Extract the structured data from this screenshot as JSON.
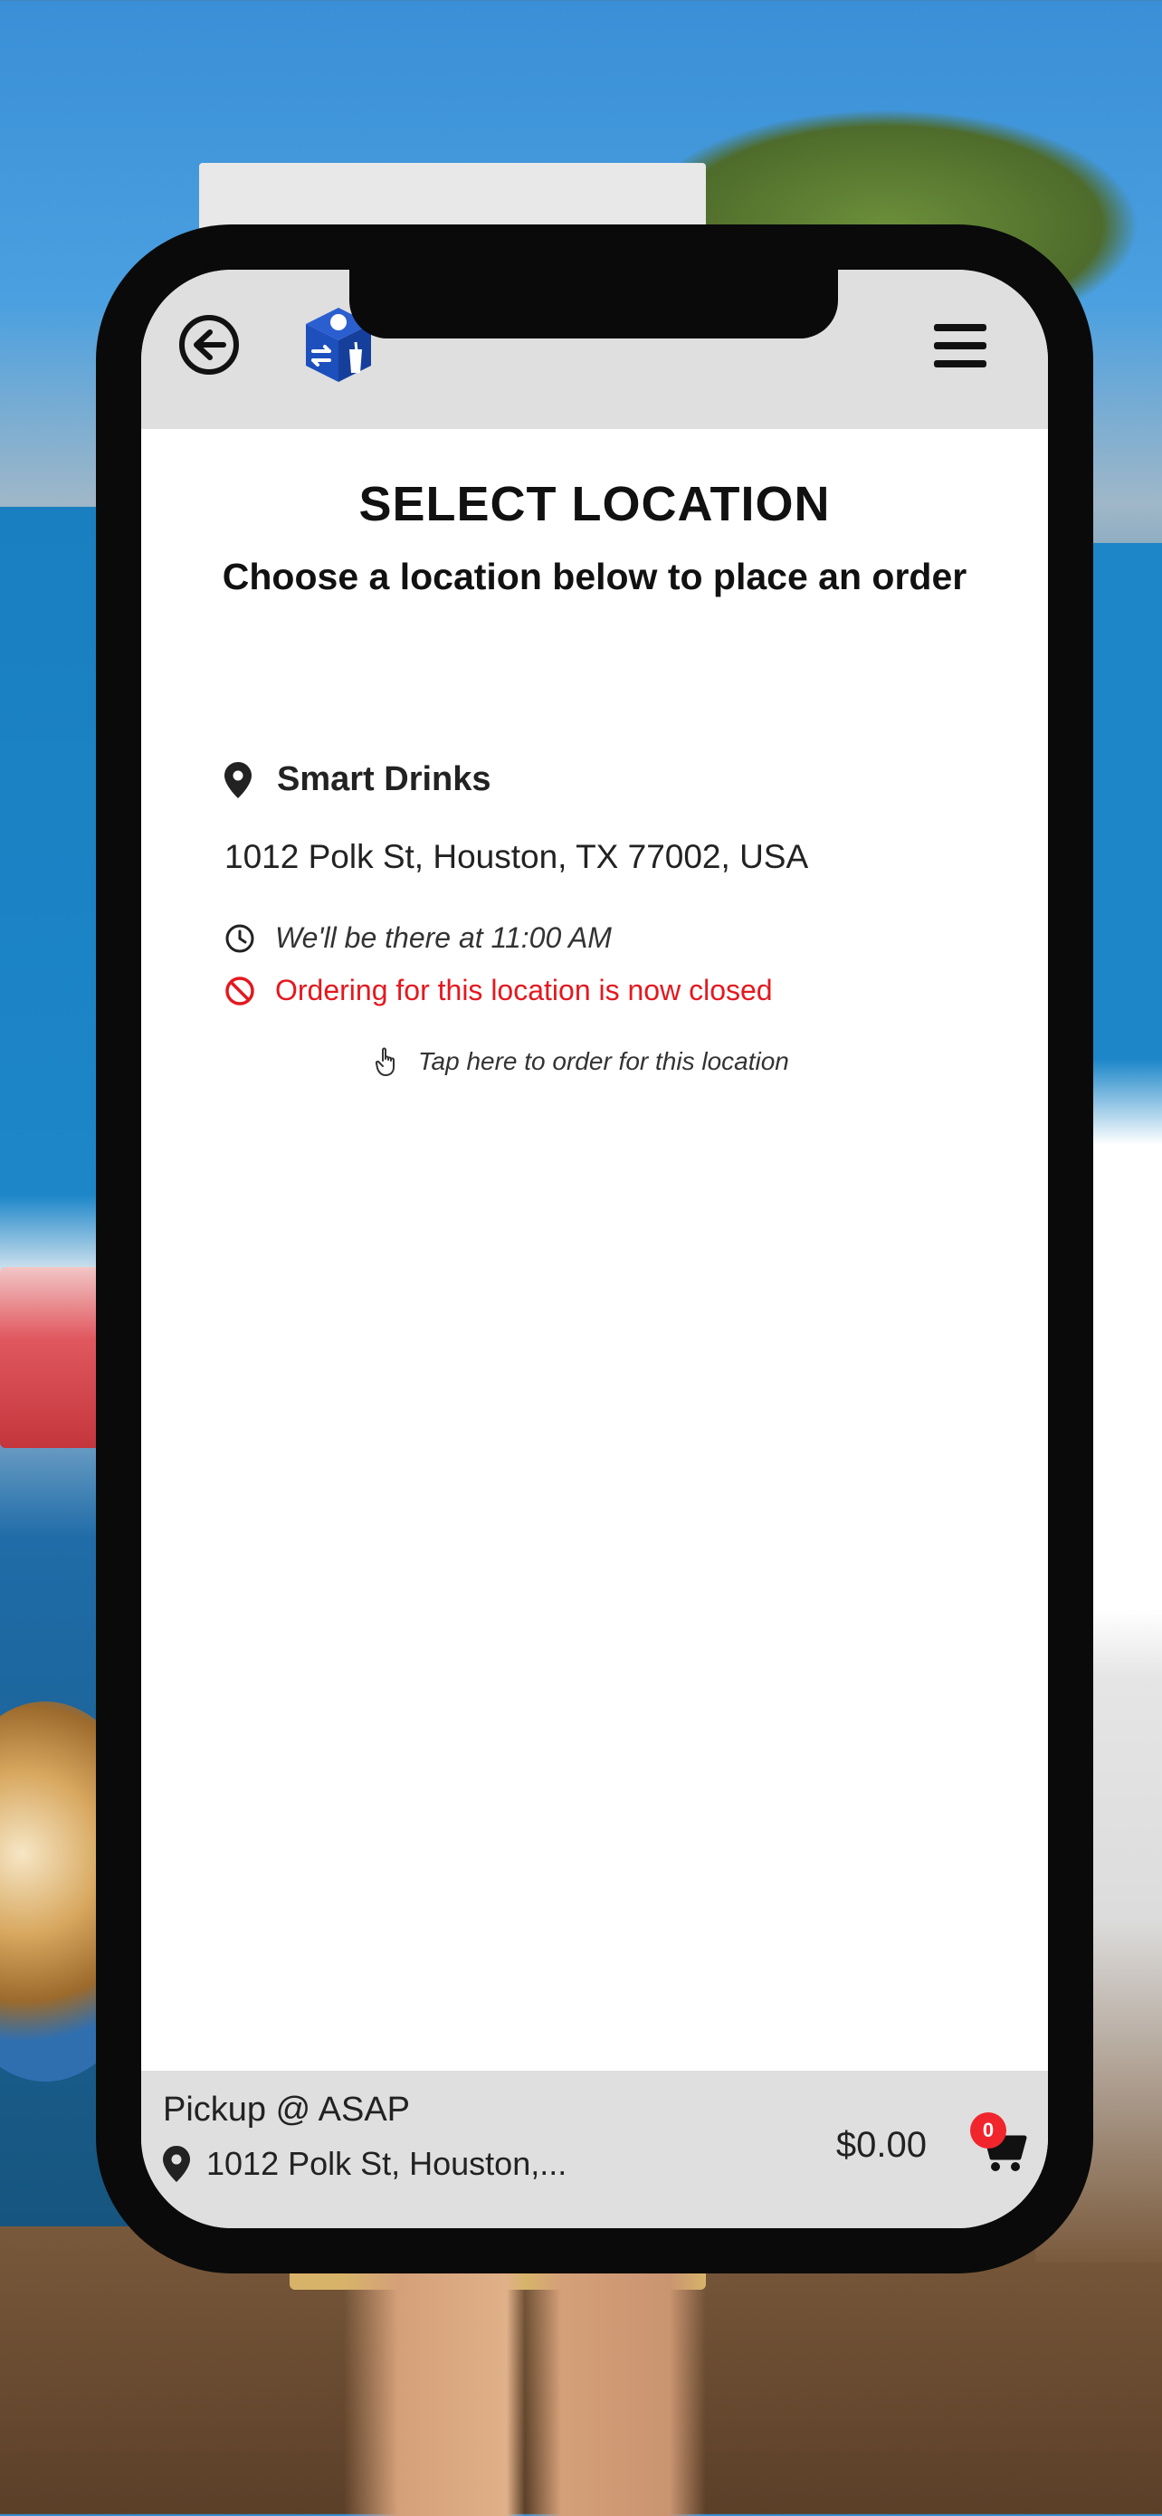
{
  "header": {
    "back_icon": "arrow-left-circle-icon",
    "logo_icon": "cube-logo-icon",
    "menu_icon": "hamburger-menu-icon"
  },
  "page": {
    "title": "SELECT LOCATION",
    "subtitle": "Choose a location below to place an order"
  },
  "locations": [
    {
      "name": "Smart Drinks",
      "address": "1012 Polk St, Houston, TX 77002, USA",
      "schedule": "We'll be there at 11:00 AM",
      "status": "Ordering for this location is now closed",
      "action_hint": "Tap here to order for this location",
      "icons": {
        "pin": "map-pin-icon",
        "clock": "clock-icon",
        "status": "ban-icon",
        "tap": "hand-pointer-icon"
      }
    }
  ],
  "footer": {
    "pickup_label": "Pickup @ ASAP",
    "pickup_address": "1012 Polk St, Houston,...",
    "cart_total": "$0.00",
    "cart_count": "0",
    "cart_icon": "cart-icon"
  },
  "colors": {
    "status_closed": "#e4181f",
    "bar_background": "#dfdfdf",
    "logo_blue": "#1d4fbd",
    "badge_red": "#f0262c"
  }
}
